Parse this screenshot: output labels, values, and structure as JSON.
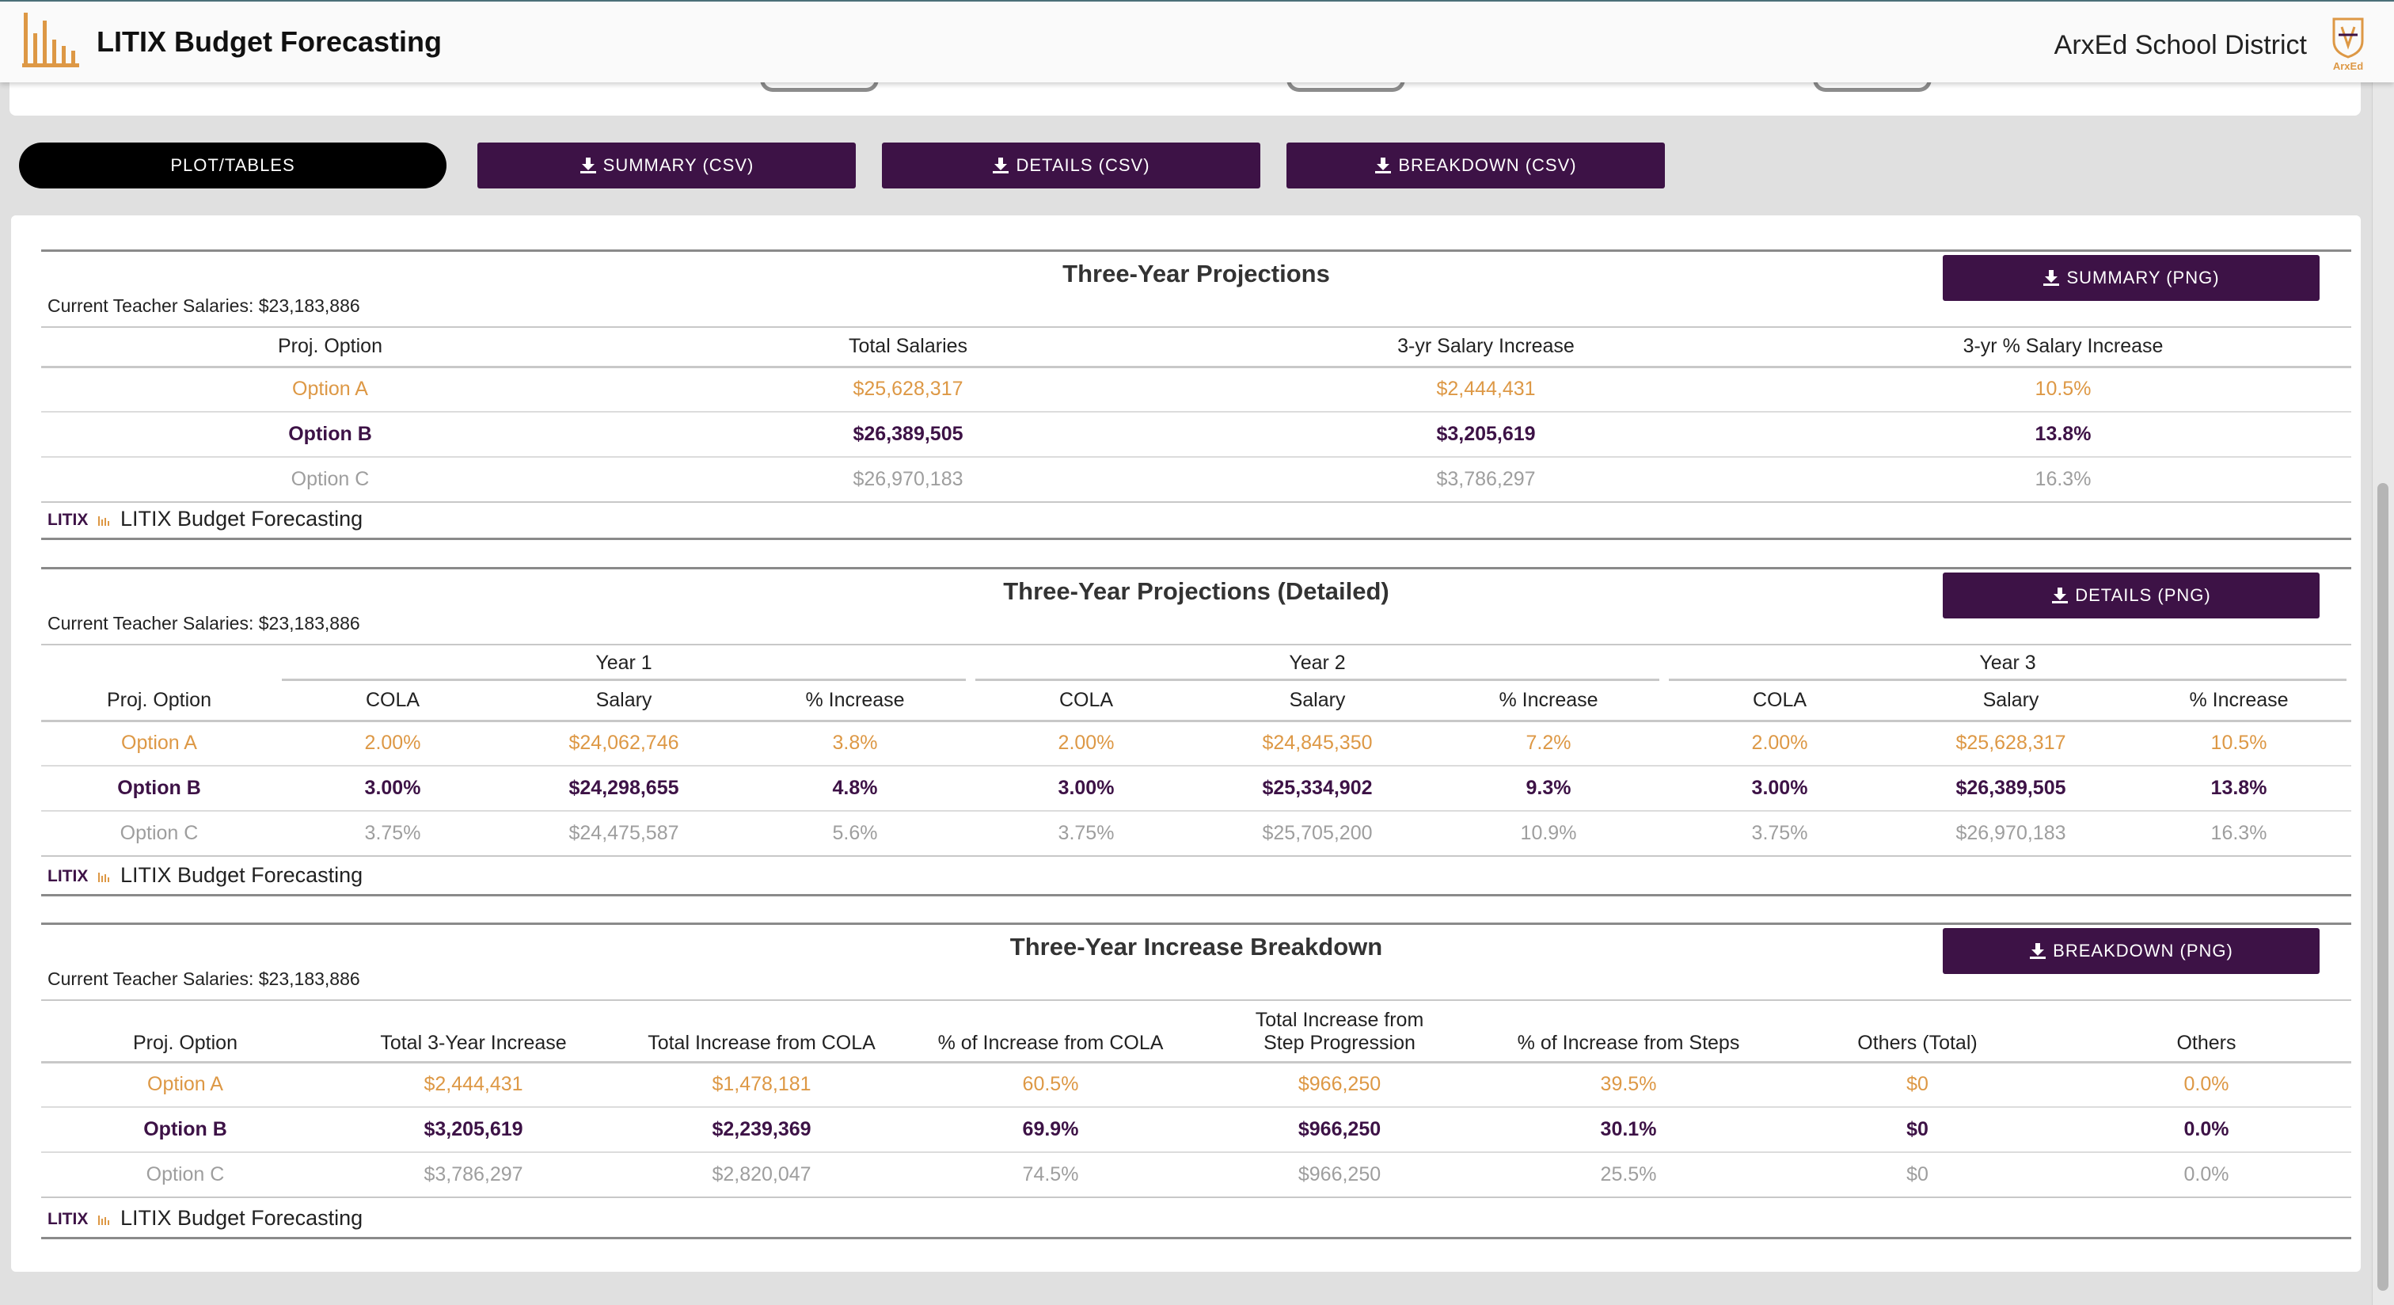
{
  "header": {
    "app_title": "LITIX Budget Forecasting",
    "district_name": "ArxEd School District",
    "district_logo_text": "ArxEd"
  },
  "toolbar": {
    "plot_tables_label": "PLOT/TABLES",
    "summary_csv_label": "SUMMARY (CSV)",
    "details_csv_label": "DETAILS (CSV)",
    "breakdown_csv_label": "BREAKDOWN (CSV)"
  },
  "colors": {
    "brand_purple": "#3d1246",
    "option_a": "#dd9845",
    "option_b": "#3d1246",
    "option_c": "#9e9e9e",
    "logo_orange": "#dd9845"
  },
  "footer": {
    "brand_text": "LITIX Budget Forecasting",
    "mark_text": "LITIX"
  },
  "summary": {
    "title": "Three-Year Projections",
    "subtitle": "Current Teacher Salaries: $23,183,886",
    "png_label": "SUMMARY (PNG)",
    "columns": [
      "Proj. Option",
      "Total Salaries",
      "3-yr Salary Increase",
      "3-yr % Salary Increase"
    ],
    "rows": [
      [
        "Option A",
        "$25,628,317",
        "$2,444,431",
        "10.5%"
      ],
      [
        "Option B",
        "$26,389,505",
        "$3,205,619",
        "13.8%"
      ],
      [
        "Option C",
        "$26,970,183",
        "$3,786,297",
        "16.3%"
      ]
    ]
  },
  "details": {
    "title": "Three-Year Projections (Detailed)",
    "subtitle": "Current Teacher Salaries: $23,183,886",
    "png_label": "DETAILS (PNG)",
    "groups": [
      "Year 1",
      "Year 2",
      "Year 3"
    ],
    "columns": [
      "Proj. Option",
      "COLA",
      "Salary",
      "% Increase",
      "COLA",
      "Salary",
      "% Increase",
      "COLA",
      "Salary",
      "% Increase"
    ],
    "rows": [
      [
        "Option A",
        "2.00%",
        "$24,062,746",
        "3.8%",
        "2.00%",
        "$24,845,350",
        "7.2%",
        "2.00%",
        "$25,628,317",
        "10.5%"
      ],
      [
        "Option B",
        "3.00%",
        "$24,298,655",
        "4.8%",
        "3.00%",
        "$25,334,902",
        "9.3%",
        "3.00%",
        "$26,389,505",
        "13.8%"
      ],
      [
        "Option C",
        "3.75%",
        "$24,475,587",
        "5.6%",
        "3.75%",
        "$25,705,200",
        "10.9%",
        "3.75%",
        "$26,970,183",
        "16.3%"
      ]
    ]
  },
  "breakdown": {
    "title": "Three-Year Increase Breakdown",
    "subtitle": "Current Teacher Salaries: $23,183,886",
    "png_label": "BREAKDOWN (PNG)",
    "columns": [
      "Proj. Option",
      "Total 3-Year Increase",
      "Total Increase from COLA",
      "% of Increase from COLA",
      "Total Increase from Step Progression",
      "% of Increase from Steps",
      "Others (Total)",
      "Others"
    ],
    "rows": [
      [
        "Option A",
        "$2,444,431",
        "$1,478,181",
        "60.5%",
        "$966,250",
        "39.5%",
        "$0",
        "0.0%"
      ],
      [
        "Option B",
        "$3,205,619",
        "$2,239,369",
        "69.9%",
        "$966,250",
        "30.1%",
        "$0",
        "0.0%"
      ],
      [
        "Option C",
        "$3,786,297",
        "$2,820,047",
        "74.5%",
        "$966,250",
        "25.5%",
        "$0",
        "0.0%"
      ]
    ]
  }
}
